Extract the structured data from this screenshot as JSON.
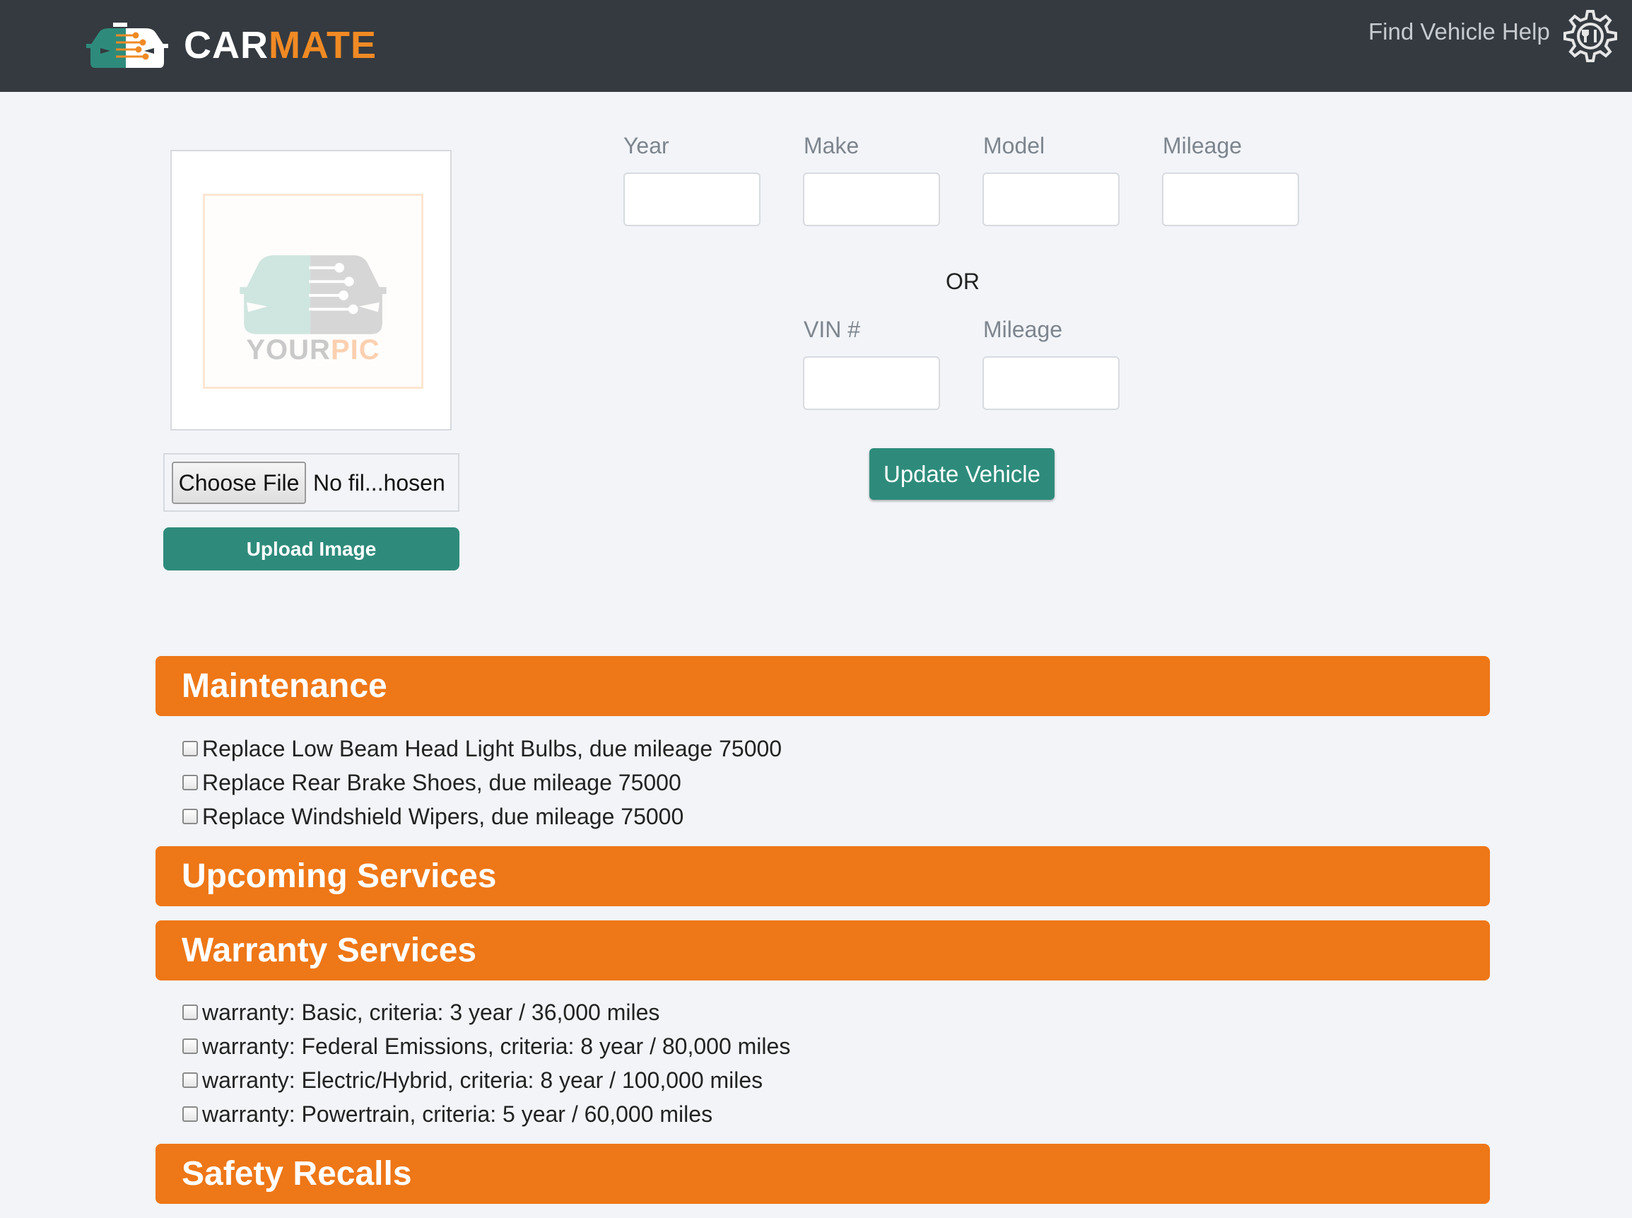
{
  "navbar": {
    "brand_part1": "CAR",
    "brand_part2": "MATE",
    "help_link": "Find Vehicle Help",
    "brand_accent_color": "#f08a24",
    "background_color": "#343a40"
  },
  "image_panel": {
    "placeholder_part1": "YOUR",
    "placeholder_part2": "PIC",
    "choose_file_label": "Choose File",
    "file_status": "No fil...hosen",
    "upload_label": "Upload Image"
  },
  "vehicle_form": {
    "year_label": "Year",
    "make_label": "Make",
    "model_label": "Model",
    "mileage_label": "Mileage",
    "or_label": "OR",
    "vin_label": "VIN #",
    "vin_mileage_label": "Mileage",
    "update_label": "Update Vehicle",
    "year_value": "",
    "make_value": "",
    "model_value": "",
    "mileage_value": "",
    "vin_value": "",
    "vin_mileage_value": ""
  },
  "sections": {
    "maintenance": {
      "title": "Maintenance",
      "items": [
        "Replace Low Beam Head Light Bulbs, due mileage 75000",
        "Replace Rear Brake Shoes, due mileage 75000",
        "Replace Windshield Wipers, due mileage 75000"
      ]
    },
    "upcoming": {
      "title": "Upcoming Services"
    },
    "warranty": {
      "title": "Warranty Services",
      "items": [
        "warranty: Basic, criteria: 3 year / 36,000 miles",
        "warranty: Federal Emissions, criteria: 8 year / 80,000 miles",
        "warranty: Electric/Hybrid, criteria: 8 year / 100,000 miles",
        "warranty: Powertrain, criteria: 5 year / 60,000 miles"
      ]
    },
    "recalls": {
      "title": "Safety Recalls"
    }
  },
  "colors": {
    "section_bar": "#ee7717",
    "primary_button": "#2e8b7b",
    "page_background": "#f2f4f8"
  }
}
